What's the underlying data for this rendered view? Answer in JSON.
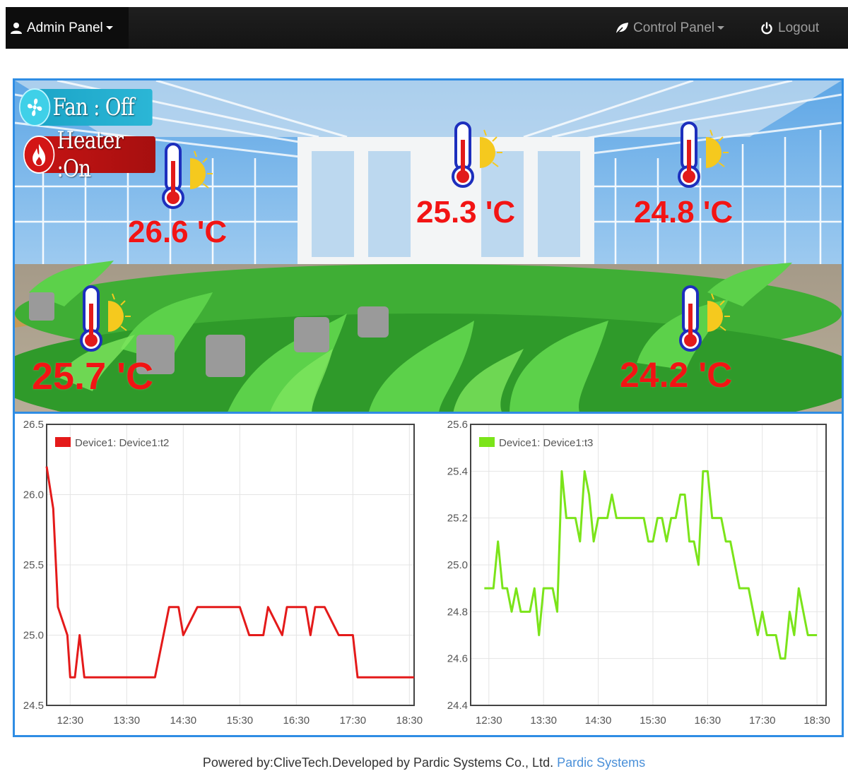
{
  "navbar": {
    "admin_label": "Admin Panel",
    "control_label": "Control Panel",
    "logout_label": "Logout"
  },
  "scene": {
    "fan_status": "Fan : Off",
    "heater_status": "Heater :On",
    "sensors": [
      {
        "temp": "26.6 'C"
      },
      {
        "temp": "25.3 'C"
      },
      {
        "temp": "24.8 'C"
      },
      {
        "temp": "25.7 'C"
      },
      {
        "temp": "24.2 'C"
      }
    ]
  },
  "colors": {
    "accent_border": "#2f8de4",
    "temp_text": "#f21414",
    "series_t2": "#e41a1a",
    "series_t3": "#7be41a"
  },
  "chart_data": [
    {
      "type": "line",
      "x_ticks": [
        "12:30",
        "13:30",
        "14:30",
        "15:30",
        "16:30",
        "17:30",
        "18:30"
      ],
      "y_ticks": [
        "24.5",
        "25.0",
        "25.5",
        "26.0",
        "26.5"
      ],
      "ylim": [
        24.5,
        26.5
      ],
      "xlim": [
        "12:05",
        "18:35"
      ],
      "legend_placement": "top-left",
      "series": [
        {
          "name": "Device1: Device1:t2",
          "x": [
            "12:05",
            "12:12",
            "12:17",
            "12:27",
            "12:30",
            "12:35",
            "12:40",
            "12:45",
            "13:00",
            "13:15",
            "13:30",
            "13:45",
            "14:00",
            "14:15",
            "14:20",
            "14:25",
            "14:30",
            "14:45",
            "15:00",
            "15:10",
            "15:20",
            "15:30",
            "15:40",
            "15:45",
            "15:50",
            "15:55",
            "16:00",
            "16:15",
            "16:20",
            "16:30",
            "16:40",
            "16:45",
            "16:50",
            "17:00",
            "17:15",
            "17:30",
            "17:35",
            "17:45",
            "18:00",
            "18:15",
            "18:30",
            "18:35"
          ],
          "y": [
            26.2,
            25.9,
            25.2,
            25.0,
            24.7,
            24.7,
            25.0,
            24.7,
            24.7,
            24.7,
            24.7,
            24.7,
            24.7,
            25.2,
            25.2,
            25.2,
            25.0,
            25.2,
            25.2,
            25.2,
            25.2,
            25.2,
            25.0,
            25.0,
            25.0,
            25.0,
            25.2,
            25.0,
            25.2,
            25.2,
            25.2,
            25.0,
            25.2,
            25.2,
            25.0,
            25.0,
            24.7,
            24.7,
            24.7,
            24.7,
            24.7,
            24.7
          ]
        }
      ]
    },
    {
      "type": "line",
      "x_ticks": [
        "12:30",
        "13:30",
        "14:30",
        "15:30",
        "16:30",
        "17:30",
        "18:30"
      ],
      "y_ticks": [
        "24.4",
        "24.6",
        "24.8",
        "25.0",
        "25.2",
        "25.4",
        "25.6"
      ],
      "ylim": [
        24.4,
        25.6
      ],
      "xlim": [
        "12:10",
        "18:40"
      ],
      "legend_placement": "top-left",
      "series": [
        {
          "name": "Device1: Device1:t3",
          "x": [
            "12:25",
            "12:30",
            "12:35",
            "12:40",
            "12:45",
            "12:50",
            "12:55",
            "13:00",
            "13:05",
            "13:10",
            "13:15",
            "13:20",
            "13:25",
            "13:30",
            "13:35",
            "13:40",
            "13:45",
            "13:50",
            "13:55",
            "14:00",
            "14:05",
            "14:10",
            "14:15",
            "14:20",
            "14:25",
            "14:30",
            "14:35",
            "14:40",
            "14:45",
            "14:50",
            "14:55",
            "15:00",
            "15:05",
            "15:10",
            "15:15",
            "15:20",
            "15:25",
            "15:30",
            "15:35",
            "15:40",
            "15:45",
            "15:50",
            "15:55",
            "16:00",
            "16:05",
            "16:10",
            "16:15",
            "16:20",
            "16:25",
            "16:30",
            "16:35",
            "16:40",
            "16:45",
            "16:50",
            "16:55",
            "17:00",
            "17:05",
            "17:10",
            "17:15",
            "17:20",
            "17:25",
            "17:30",
            "17:35",
            "17:40",
            "17:45",
            "17:50",
            "17:55",
            "18:00",
            "18:05",
            "18:10",
            "18:15",
            "18:20",
            "18:25",
            "18:30"
          ],
          "y": [
            24.9,
            24.9,
            24.9,
            25.1,
            24.9,
            24.9,
            24.8,
            24.9,
            24.8,
            24.8,
            24.8,
            24.9,
            24.7,
            24.9,
            24.9,
            24.9,
            24.8,
            25.4,
            25.2,
            25.2,
            25.2,
            25.1,
            25.4,
            25.3,
            25.1,
            25.2,
            25.2,
            25.2,
            25.3,
            25.2,
            25.2,
            25.2,
            25.2,
            25.2,
            25.2,
            25.2,
            25.1,
            25.1,
            25.2,
            25.2,
            25.1,
            25.2,
            25.2,
            25.3,
            25.3,
            25.1,
            25.1,
            25.0,
            25.4,
            25.4,
            25.2,
            25.2,
            25.2,
            25.1,
            25.1,
            25.0,
            24.9,
            24.9,
            24.9,
            24.8,
            24.7,
            24.8,
            24.7,
            24.7,
            24.7,
            24.6,
            24.6,
            24.8,
            24.7,
            24.9,
            24.8,
            24.7,
            24.7,
            24.7
          ]
        }
      ]
    }
  ],
  "footer": {
    "text": "Powered by:CliveTech.Developed by Pardic Systems Co., Ltd.",
    "link": "Pardic Systems"
  }
}
